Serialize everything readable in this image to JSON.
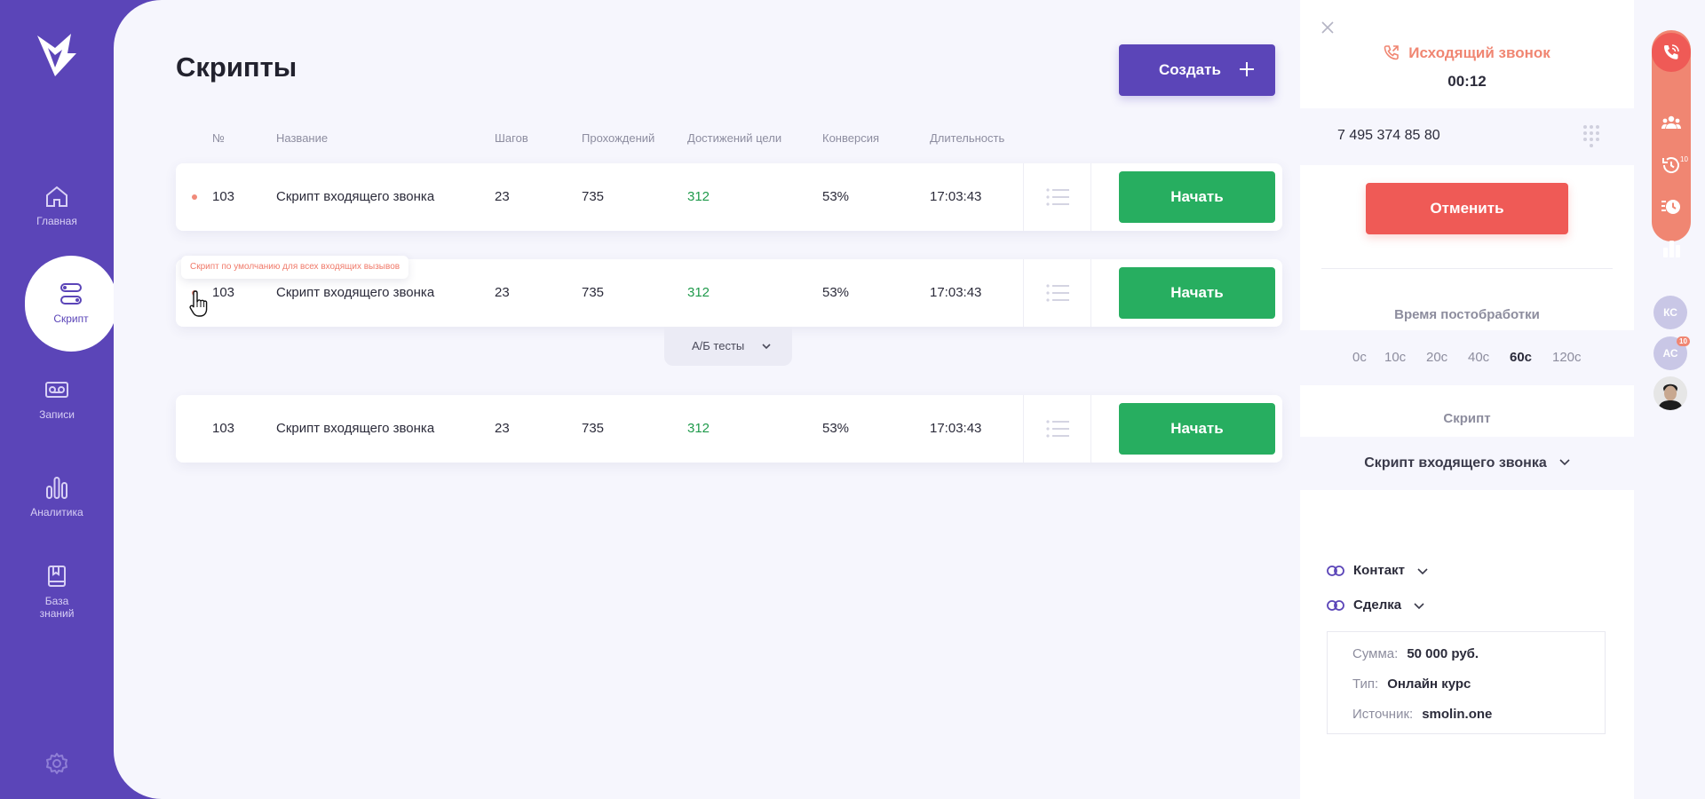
{
  "sidebar": {
    "items": [
      {
        "label": "Главная",
        "icon": "home-icon"
      },
      {
        "label": "Скрипт",
        "icon": "script-icon",
        "active": true
      },
      {
        "label": "Записи",
        "icon": "voicemail-icon"
      },
      {
        "label": "Аналитика",
        "icon": "chart-icon"
      },
      {
        "label": "База знаний",
        "icon": "book-icon"
      }
    ],
    "settings_icon": "gear-icon"
  },
  "main": {
    "title": "Скрипты",
    "create_label": "Создать",
    "columns": [
      "№",
      "Название",
      "Шагов",
      "Прохождений",
      "Достижений цели",
      "Конверсия",
      "Длительность"
    ],
    "rows": [
      {
        "num": "103",
        "name": "Скрипт входящего звонка",
        "steps": "23",
        "passes": "735",
        "goals": "312",
        "conversion": "53%",
        "duration": "17:03:43",
        "action": "Начать"
      },
      {
        "num": "103",
        "name": "Скрипт входящего звонка",
        "steps": "23",
        "passes": "735",
        "goals": "312",
        "conversion": "53%",
        "duration": "17:03:43",
        "action": "Начать"
      },
      {
        "num": "103",
        "name": "Скрипт входящего звонка",
        "steps": "23",
        "passes": "735",
        "goals": "312",
        "conversion": "53%",
        "duration": "17:03:43",
        "action": "Начать"
      }
    ],
    "tooltip": "Скрипт по умолчанию для всех входящих вызывов",
    "ab_tests_label": "А/Б тесты"
  },
  "call": {
    "title": "Исходящий звонок",
    "timer": "00:12",
    "phone": "7 495 374 85 80",
    "cancel_label": "Отменить",
    "postwork_title": "Время постобработки",
    "postwork_options": [
      "0с",
      "10с",
      "20с",
      "40с",
      "60с",
      "120с"
    ],
    "postwork_selected": "60с",
    "script_title": "Скрипт",
    "script_value": "Скрипт входящего звонка",
    "contact_label": "Контакт",
    "deal_label": "Сделка",
    "deal": {
      "sum_key": "Сумма:",
      "sum_val": "50 000 руб.",
      "type_key": "Тип:",
      "type_val": "Онлайн курс",
      "source_key": "Источник:",
      "source_val": "smolin.one"
    }
  },
  "rail": {
    "history_badge": "10",
    "avatars": [
      {
        "initials": "КС"
      },
      {
        "initials": "АС",
        "badge": "10"
      }
    ]
  },
  "colors": {
    "brand": "#5b45b8",
    "success": "#27ae60",
    "danger": "#ef5a56",
    "accent": "#f08672"
  }
}
